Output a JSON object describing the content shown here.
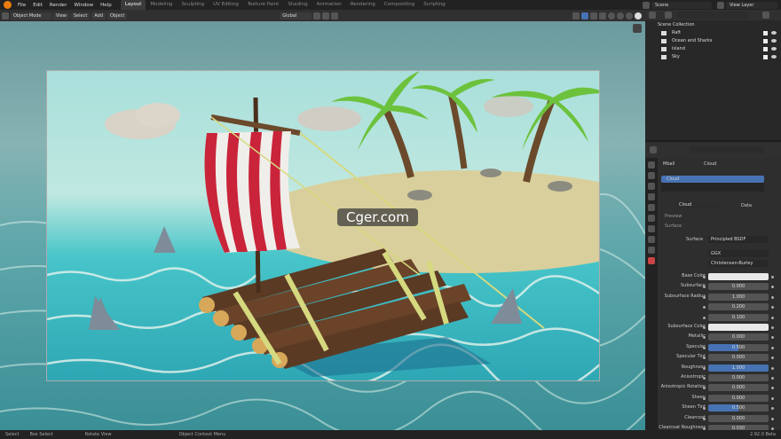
{
  "menu": [
    "File",
    "Edit",
    "Render",
    "Window",
    "Help"
  ],
  "workspaces": [
    "Layout",
    "Modeling",
    "Sculpting",
    "UV Editing",
    "Texture Paint",
    "Shading",
    "Animation",
    "Rendering",
    "Compositing",
    "Scripting"
  ],
  "active_workspace": "Layout",
  "scene": "Scene",
  "view_layer": "View Layer",
  "viewport_header": {
    "mode": "Object Mode",
    "menus": [
      "View",
      "Select",
      "Add",
      "Object"
    ],
    "orientation": "Global"
  },
  "watermark": "Cger.com",
  "outliner": {
    "root": "Scene Collection",
    "items": [
      "Raft",
      "Ocean and Sharks",
      "Island",
      "Sky"
    ]
  },
  "properties": {
    "object": "Mball",
    "material_tab": "Cloud",
    "slot": "Cloud",
    "material_name": "Cloud",
    "data_label": "Data",
    "preview": "Preview",
    "surface_panel": "Surface",
    "surface_label": "Surface",
    "surface_shader": "Principled BSDF",
    "distribution": "GGX",
    "sss_method": "Christensen-Burley",
    "fields": [
      {
        "label": "Base Color",
        "value": "",
        "kind": "white"
      },
      {
        "label": "Subsurface",
        "value": "0.000",
        "kind": "num"
      },
      {
        "label": "Subsurface Radius",
        "value": "1.000",
        "kind": "num"
      },
      {
        "label": "",
        "value": "0.200",
        "kind": "num"
      },
      {
        "label": "",
        "value": "0.100",
        "kind": "num"
      },
      {
        "label": "Subsurface Color",
        "value": "",
        "kind": "white"
      },
      {
        "label": "Metallic",
        "value": "0.000",
        "kind": "num"
      },
      {
        "label": "Specular",
        "value": "0.500",
        "kind": "blue",
        "fill": 0.5
      },
      {
        "label": "Specular Tint",
        "value": "0.000",
        "kind": "num"
      },
      {
        "label": "Roughness",
        "value": "1.000",
        "kind": "blue",
        "fill": 1.0
      },
      {
        "label": "Anisotropic",
        "value": "0.000",
        "kind": "num"
      },
      {
        "label": "Anisotropic Rotation",
        "value": "0.000",
        "kind": "num"
      },
      {
        "label": "Sheen",
        "value": "0.000",
        "kind": "num"
      },
      {
        "label": "Sheen Tint",
        "value": "0.500",
        "kind": "blue",
        "fill": 0.5
      },
      {
        "label": "Clearcoat",
        "value": "0.000",
        "kind": "num"
      },
      {
        "label": "Clearcoat Roughness",
        "value": "0.030",
        "kind": "num"
      }
    ]
  },
  "status": {
    "select": "Select",
    "box_select": "Box Select",
    "rotate": "Rotate View",
    "context": "Object Context Menu",
    "version": "2.92.0 Beta"
  }
}
